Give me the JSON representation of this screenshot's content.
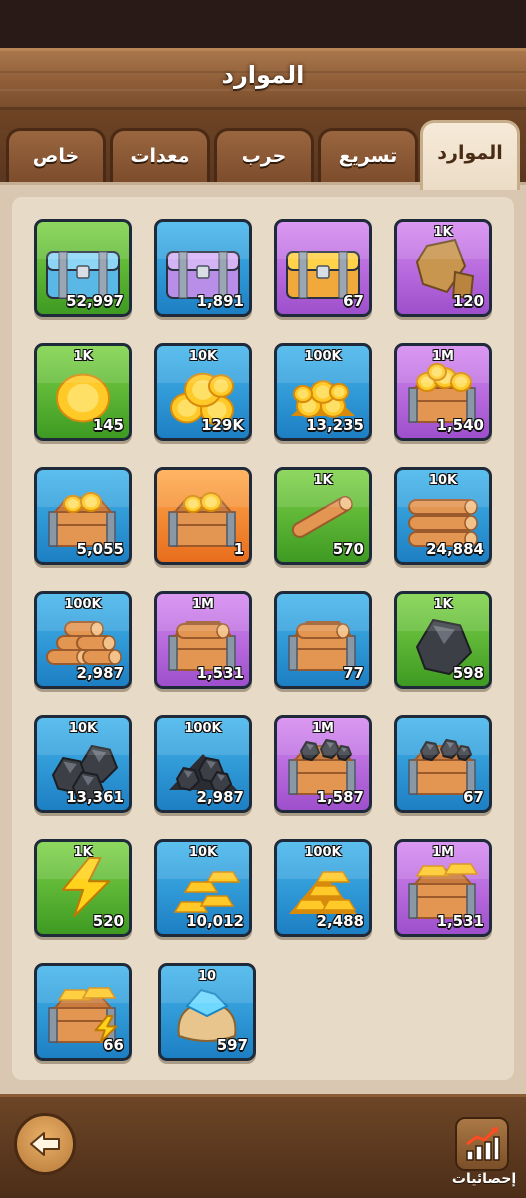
{
  "header": {
    "title": "الموارد"
  },
  "tabs": [
    {
      "label": "الموارد",
      "active": true
    },
    {
      "label": "تسريع",
      "active": false
    },
    {
      "label": "حرب",
      "active": false
    },
    {
      "label": "معدات",
      "active": false
    },
    {
      "label": "خاص",
      "active": false
    }
  ],
  "tiles": [
    {
      "icon": "blue-chest-icon",
      "amount": "",
      "count": "52,997",
      "bg": "green"
    },
    {
      "icon": "purple-chest-icon",
      "amount": "",
      "count": "1,891",
      "bg": "blue"
    },
    {
      "icon": "gold-chest-icon",
      "amount": "",
      "count": "67",
      "bg": "purple"
    },
    {
      "icon": "stone-icon",
      "amount": "1K",
      "count": "120",
      "bg": "purple"
    },
    {
      "icon": "gold-coin-icon",
      "amount": "1K",
      "count": "145",
      "bg": "green"
    },
    {
      "icon": "gold-coins-pile-icon",
      "amount": "10K",
      "count": "129K",
      "bg": "blue"
    },
    {
      "icon": "gold-coins-heap-icon",
      "amount": "100K",
      "count": "13,235",
      "bg": "blue"
    },
    {
      "icon": "gold-coins-crate-icon",
      "amount": "1M",
      "count": "1,540",
      "bg": "purple"
    },
    {
      "icon": "gold-crate-icon",
      "amount": "",
      "count": "5,055",
      "bg": "blue"
    },
    {
      "icon": "gold-crate-icon",
      "amount": "",
      "count": "1",
      "bg": "orange"
    },
    {
      "icon": "wood-log-icon",
      "amount": "1K",
      "count": "570",
      "bg": "green"
    },
    {
      "icon": "wood-logs-icon",
      "amount": "10K",
      "count": "24,884",
      "bg": "blue"
    },
    {
      "icon": "wood-pile-icon",
      "amount": "100K",
      "count": "2,987",
      "bg": "blue"
    },
    {
      "icon": "wood-crate-icon",
      "amount": "1M",
      "count": "1,531",
      "bg": "purple"
    },
    {
      "icon": "wood-crate-icon",
      "amount": "",
      "count": "77",
      "bg": "blue"
    },
    {
      "icon": "ore-rock-icon",
      "amount": "1K",
      "count": "598",
      "bg": "green"
    },
    {
      "icon": "ore-rocks-icon",
      "amount": "10K",
      "count": "13,361",
      "bg": "blue"
    },
    {
      "icon": "ore-heap-icon",
      "amount": "100K",
      "count": "2,987",
      "bg": "blue"
    },
    {
      "icon": "ore-crate-icon",
      "amount": "1M",
      "count": "1,587",
      "bg": "purple"
    },
    {
      "icon": "ore-crate-icon",
      "amount": "",
      "count": "67",
      "bg": "blue"
    },
    {
      "icon": "lightning-icon",
      "amount": "1K",
      "count": "520",
      "bg": "green"
    },
    {
      "icon": "gold-bars-icon",
      "amount": "10K",
      "count": "10,012",
      "bg": "blue"
    },
    {
      "icon": "gold-bars-heap-icon",
      "amount": "100K",
      "count": "2,488",
      "bg": "blue"
    },
    {
      "icon": "gold-bars-crate-icon",
      "amount": "1M",
      "count": "1,531",
      "bg": "purple"
    },
    {
      "icon": "gold-bars-crate-lightning-icon",
      "amount": "",
      "count": "66",
      "bg": "blue"
    },
    {
      "icon": "gem-sack-icon",
      "amount": "10",
      "count": "597",
      "bg": "blue"
    }
  ],
  "footer": {
    "back_icon": "back-arrow-icon",
    "stats_icon": "chart-icon",
    "stats_label": "إحصائيات"
  }
}
